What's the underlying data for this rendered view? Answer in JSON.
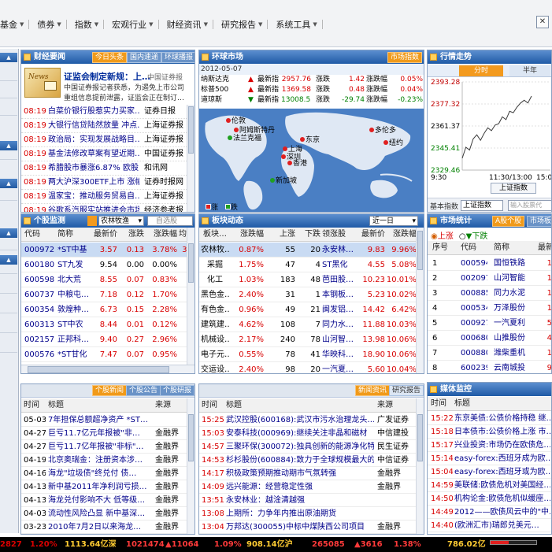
{
  "menu": [
    "基金",
    "债券",
    "指数",
    "宏观行业",
    "财经资讯",
    "研究报告",
    "系统工具"
  ],
  "finance_news": {
    "title": "财经要闻",
    "tabs": [
      "今日头条",
      "国内速递",
      "环球播报"
    ],
    "headline": "证监会制定新规：上…",
    "headline_source": "中国证券报",
    "summary1": "中国证券报记者获悉，为遏免上市公司",
    "summary2": "重组信息提前泄露，证监会正在制订…",
    "items": [
      [
        "08:19",
        "白菜价银行股惹实力买家…",
        "证券日报"
      ],
      [
        "08:19",
        "大银行信贷陆然放量 冲点…",
        "上海证券报"
      ],
      [
        "08:19",
        "政治局：实现发展战略目…",
        "上海证券报"
      ],
      [
        "08:19",
        "基金法修改草案有望近期…",
        "中国证券报"
      ],
      [
        "08:19",
        "希腊股市暴涨6.87% 欧股…",
        "和讯网"
      ],
      [
        "08:19",
        "两大沪深300ETF上市 涨幅…",
        "证券时报网"
      ],
      [
        "08:19",
        "温家宝：推动服务贸易自…",
        "上海证券报"
      ],
      [
        "08:19",
        "谷歌系汽服实站推进会市场…",
        "经济参考报"
      ]
    ]
  },
  "global_market": {
    "title": "环球市场",
    "tab": "市场指数",
    "date": "2012-05-07",
    "rows": [
      [
        "纳斯达克",
        "最新指",
        "2957.76",
        "涨跌",
        "1.42",
        "涨跌幅",
        "0.05%",
        "up"
      ],
      [
        "标普500",
        "最新指",
        "1369.58",
        "涨跌",
        "0.48",
        "涨跌幅",
        "0.04%",
        "up"
      ],
      [
        "道琼斯",
        "最新指",
        "13008.53",
        "涨跌",
        "-29.74",
        "涨跌幅",
        "-0.23%",
        "down"
      ]
    ],
    "cities": [
      "伦敦",
      "阿姆斯特丹",
      "法兰克福",
      "东京",
      "多伦多",
      "纽约",
      "上海",
      "深圳",
      "香港",
      "新加坡"
    ],
    "legend": [
      "涨",
      "跌"
    ]
  },
  "trend": {
    "title": "行情走势",
    "tabs": [
      "分时",
      "半年"
    ],
    "yticks": [
      "2393.28",
      "2377.32",
      "2361.37",
      "2345.41",
      "2329.46"
    ],
    "xticks": [
      "9:30",
      "11:30/13:00",
      "15:00"
    ],
    "index_btn": "上证指数",
    "footer_label": "基本指数",
    "footer_select": "上证指数",
    "search_placeholder": "输入股票代"
  },
  "stock_monitor": {
    "title": "个股监测",
    "select1": "农林牧渔",
    "select2": "自选股",
    "headers": [
      "代码",
      "简称",
      "最新价",
      "涨跌",
      "涨跌幅",
      "均价"
    ],
    "rows": [
      [
        "000972",
        "*ST中基",
        "3.57",
        "0.13",
        "3.78%",
        "3.5",
        "sel",
        "red"
      ],
      [
        "600180",
        "ST九发",
        "9.54",
        "0.00",
        "0.00%",
        "9.",
        "",
        "blk"
      ],
      [
        "600598",
        "北大荒",
        "8.55",
        "0.07",
        "0.83%",
        "8.",
        "",
        "red"
      ],
      [
        "600737",
        "中粮屯…",
        "7.18",
        "0.12",
        "1.70%",
        "7.",
        "",
        "red"
      ],
      [
        "600354",
        "敦煌种…",
        "6.73",
        "0.15",
        "2.28%",
        "6.",
        "",
        "red"
      ],
      [
        "600313",
        "ST中农",
        "8.44",
        "0.01",
        "0.12%",
        "8.",
        "",
        "red"
      ],
      [
        "002157",
        "正邦科…",
        "9.40",
        "0.27",
        "2.96%",
        "9.",
        "",
        "red"
      ],
      [
        "000576",
        "*ST甘化",
        "7.47",
        "0.07",
        "0.95%",
        "7.",
        "",
        "red"
      ],
      [
        "000735",
        "罗 牛 山",
        "5.05",
        "0.07",
        "1.41%",
        "5.",
        "",
        "red"
      ]
    ]
  },
  "sector": {
    "title": "板块动态",
    "select": "近一日",
    "headers": [
      "板块…",
      "涨跌幅",
      "上涨",
      "下跌",
      "领涨股",
      "最新价",
      "涨跌幅"
    ],
    "rows": [
      [
        "农林牧…",
        "0.87%",
        "55",
        "20",
        "永安林…",
        "9.83",
        "9.96%"
      ],
      [
        "采掘",
        "1.75%",
        "47",
        "4",
        "ST黑化",
        "4.55",
        "5.08%"
      ],
      [
        "化工",
        "1.03%",
        "183",
        "48",
        "芭田股…",
        "10.23",
        "10.01%"
      ],
      [
        "黑色金…",
        "2.40%",
        "31",
        "1",
        "本钢板…",
        "5.23",
        "10.02%"
      ],
      [
        "有色金…",
        "0.96%",
        "49",
        "21",
        "闽发铝…",
        "14.42",
        "6.42%"
      ],
      [
        "建筑建…",
        "4.62%",
        "108",
        "7",
        "同力水…",
        "11.88",
        "10.03%"
      ],
      [
        "机械设…",
        "2.17%",
        "240",
        "78",
        "山河智…",
        "13.98",
        "10.06%"
      ],
      [
        "电子元…",
        "0.55%",
        "78",
        "41",
        "华映科…",
        "18.90",
        "10.06%"
      ],
      [
        "交运设…",
        "2.40%",
        "98",
        "20",
        "一汽夏…",
        "5.60",
        "10.04%"
      ]
    ]
  },
  "market_stats": {
    "title": "市场统计",
    "tabs": [
      "A股个股",
      "市场板"
    ],
    "radio_up": "上涨",
    "radio_down": "下跌",
    "headers": [
      "序号",
      "代码",
      "简称",
      "最新"
    ],
    "rows": [
      [
        "1",
        "000594",
        "国恒铁路",
        "1"
      ],
      [
        "2",
        "002097",
        "山河智能",
        "1"
      ],
      [
        "3",
        "000885",
        "同力水泥",
        "1"
      ],
      [
        "4",
        "000534",
        "万泽股份",
        "1"
      ],
      [
        "5",
        "000927",
        "一汽夏利",
        "5"
      ],
      [
        "6",
        "000680",
        "山推股份",
        "4"
      ],
      [
        "7",
        "000880",
        "潍柴重机",
        "1"
      ],
      [
        "8",
        "600239",
        "云南城投",
        "9"
      ],
      [
        "9",
        "600000",
        "广发股份",
        "7"
      ]
    ]
  },
  "stock_news": {
    "tabs": [
      "个股新闻",
      "个股公告",
      "个股研报"
    ],
    "headers": [
      "时间",
      "标题",
      "来源"
    ],
    "rows": [
      [
        "05-03",
        "7年担保总额超净资产 *ST…",
        ""
      ],
      [
        "04-27",
        "巨亏11.7亿元年报被\"非…",
        "金融界"
      ],
      [
        "04-27",
        "巨亏11.7亿年报被\"非标\"…",
        "金融界"
      ],
      [
        "04-19",
        "北京奥瑞金：注册资本涉…",
        "金融界"
      ],
      [
        "04-16",
        "海龙\"垃圾债\"终兑付 债…",
        "金融界"
      ],
      [
        "04-13",
        "新中基2011年净利润亏损…",
        "金融界"
      ],
      [
        "04-13",
        "海龙兑付影响不大 低等级…",
        "金融界"
      ],
      [
        "04-03",
        "流动性风险凸显 新中基深…",
        "金融界"
      ],
      [
        "03-23",
        "2010年7月2日以来海龙…",
        "金融界"
      ]
    ]
  },
  "news": {
    "tabs": [
      "新闻资讯",
      "研究报告"
    ],
    "headers": [
      "时间",
      "标题",
      "来源"
    ],
    "rows": [
      [
        "15:25",
        "武汉控股(600168):武汉市污水治理龙头…",
        "广发证券"
      ],
      [
        "15:03",
        "安泰科技(000969):继续关注非晶和磁材",
        "中信建投"
      ],
      [
        "14:57",
        "三聚环保(300072):独具创新的能源净化特…",
        "民生证券"
      ],
      [
        "14:53",
        "杉杉股份(600884):致力于全球规模最大的…",
        "中信证券"
      ],
      [
        "14:17",
        "积极政策预期推动期市气氛转强",
        "金融界"
      ],
      [
        "14:09",
        "远兴能源：经营稳定性强",
        "金融界"
      ],
      [
        "13:51",
        "永安林业：越淦清越强",
        ""
      ],
      [
        "13:08",
        "上期所：力争年内推出原油期货",
        ""
      ],
      [
        "13:04",
        "万邦达(300055)中标中煤陕西公司项目",
        "金融界"
      ]
    ]
  },
  "media": {
    "title": "媒体监控",
    "headers": [
      "时间",
      "标题"
    ],
    "rows": [
      [
        "15:22",
        "东京美债:公债价格持稳 继…"
      ],
      [
        "15:18",
        "日本债市:公债价格上涨 市…"
      ],
      [
        "15:17",
        "兴业投资:市场仍在欧债危…"
      ],
      [
        "15:14",
        "easy-forex:西班牙成为欧…"
      ],
      [
        "15:04",
        "easy-forex:西班牙或为欧…"
      ],
      [
        "14:59",
        "美联储:欧债危机对美国经…"
      ],
      [
        "14:50",
        "机构论金:欧债危机似缓座…"
      ],
      [
        "14:49",
        "2012——欧债风云中的\"中…"
      ],
      [
        "14:40",
        "(欧洲汇市)瑞郎兑美元…"
      ]
    ]
  },
  "statusbar": {
    "v1": "2827",
    "v2": "1.20%",
    "v3": "1113.64亿深",
    "v4": "1021474",
    "v5": "▲11064",
    "v6": "1.09%",
    "v7": "908.14亿沪",
    "v8": "265085",
    "v9": "▲3616",
    "v10": "1.38%",
    "v11": "786.02亿"
  }
}
